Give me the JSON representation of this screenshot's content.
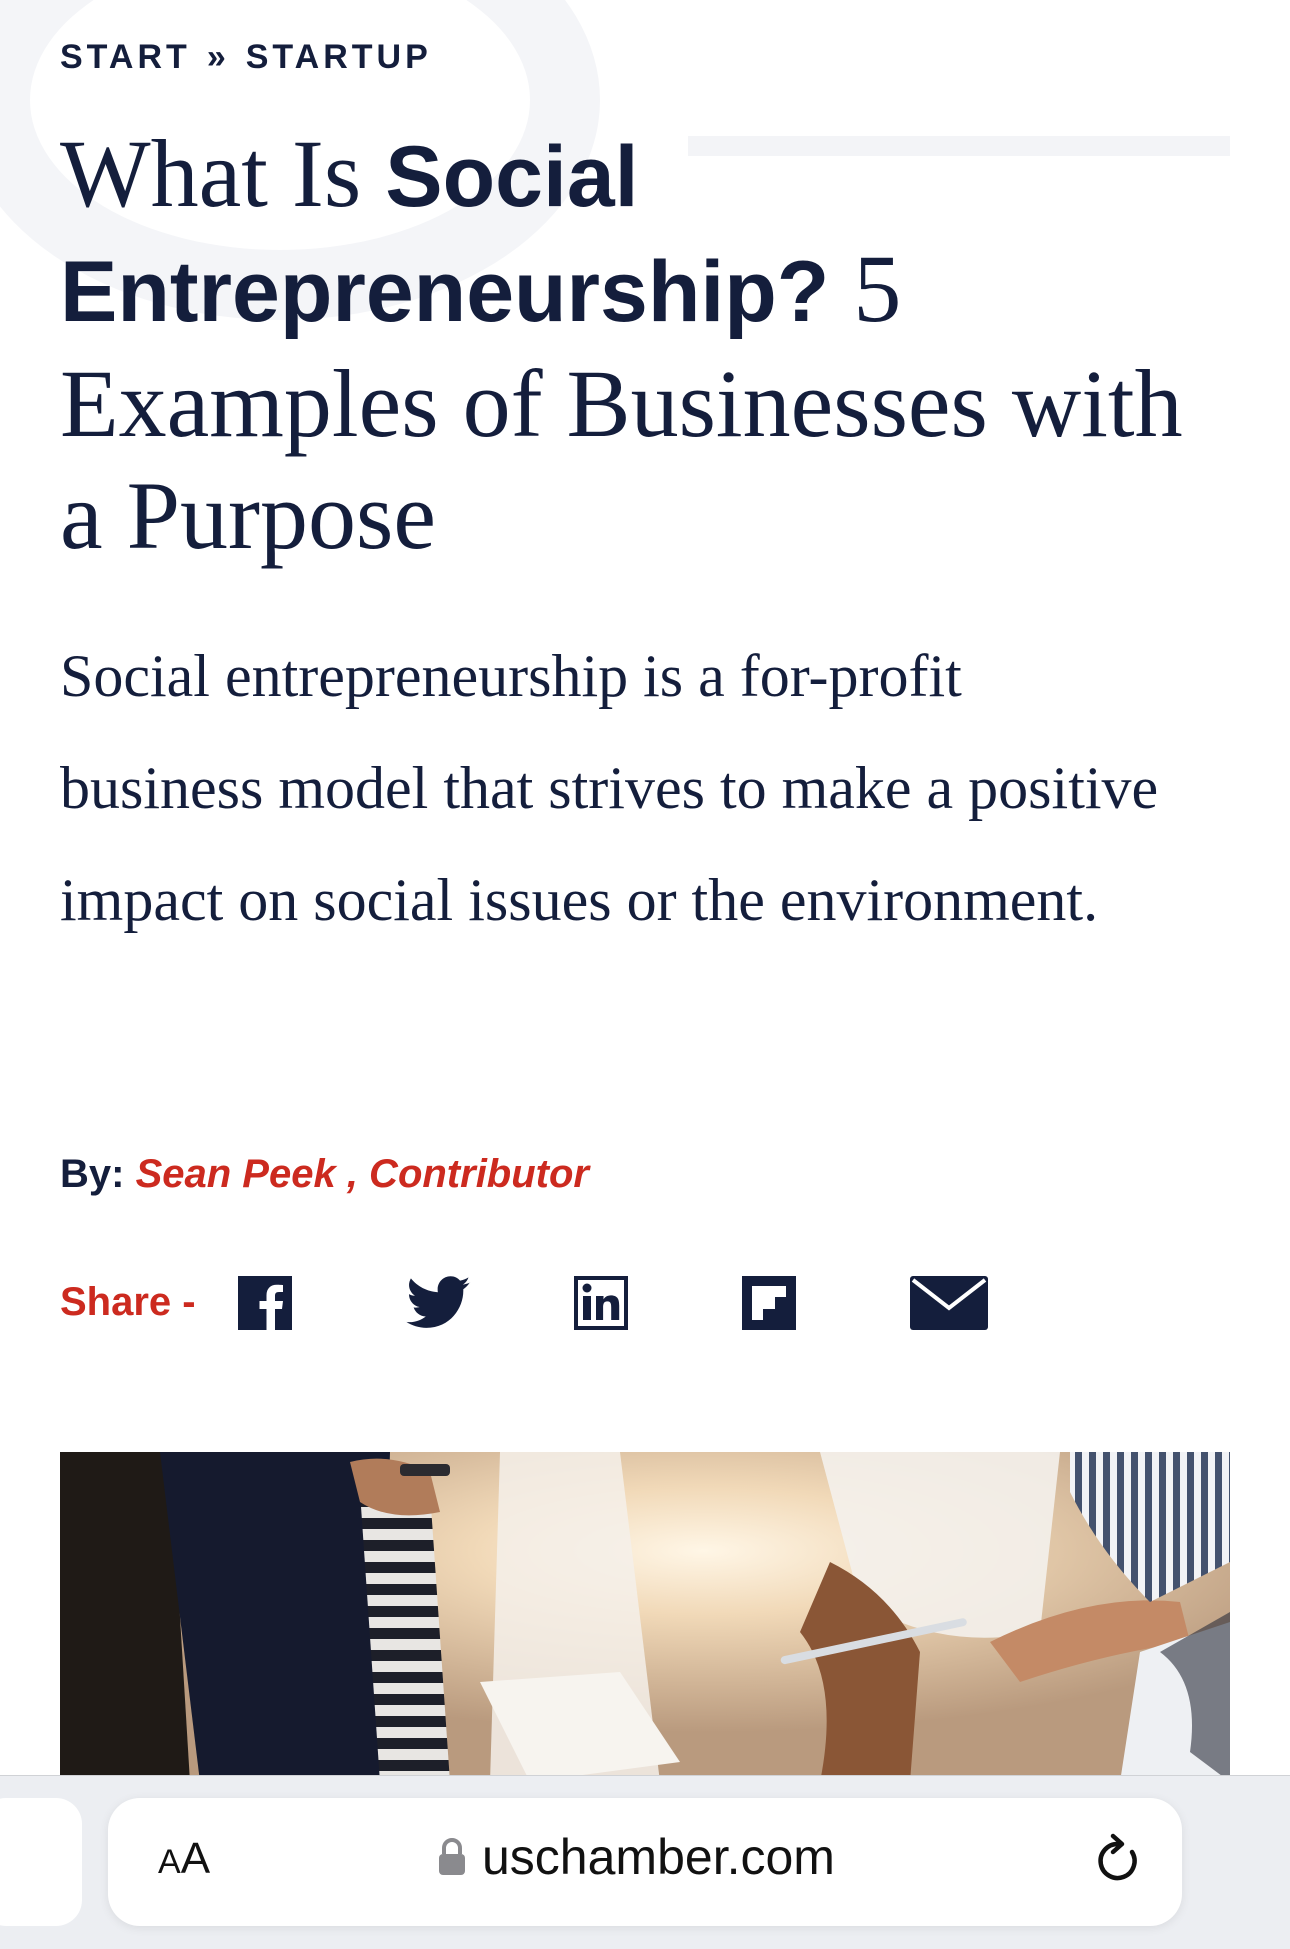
{
  "breadcrumb": {
    "items": [
      "START",
      "STARTUP"
    ],
    "separator": "»"
  },
  "article": {
    "title_part1": "What Is ",
    "title_bold": "Social Entrepreneurship?",
    "title_part2": " 5 Examples of Businesses with a Purpose",
    "summary": "Social entrepreneurship is a for-profit business model that strives to make a positive impact on social issues or the environment.",
    "byline_label": "By:",
    "author": "Sean Peek , Contributor"
  },
  "share": {
    "label": "Share -",
    "icons": [
      "facebook-icon",
      "twitter-icon",
      "linkedin-icon",
      "flipboard-icon",
      "email-icon"
    ]
  },
  "browser": {
    "text_size_label_small": "A",
    "text_size_label_large": "A",
    "url": "uschamber.com"
  },
  "colors": {
    "navy": "#141e3c",
    "accent_red": "#cc2a1f"
  }
}
